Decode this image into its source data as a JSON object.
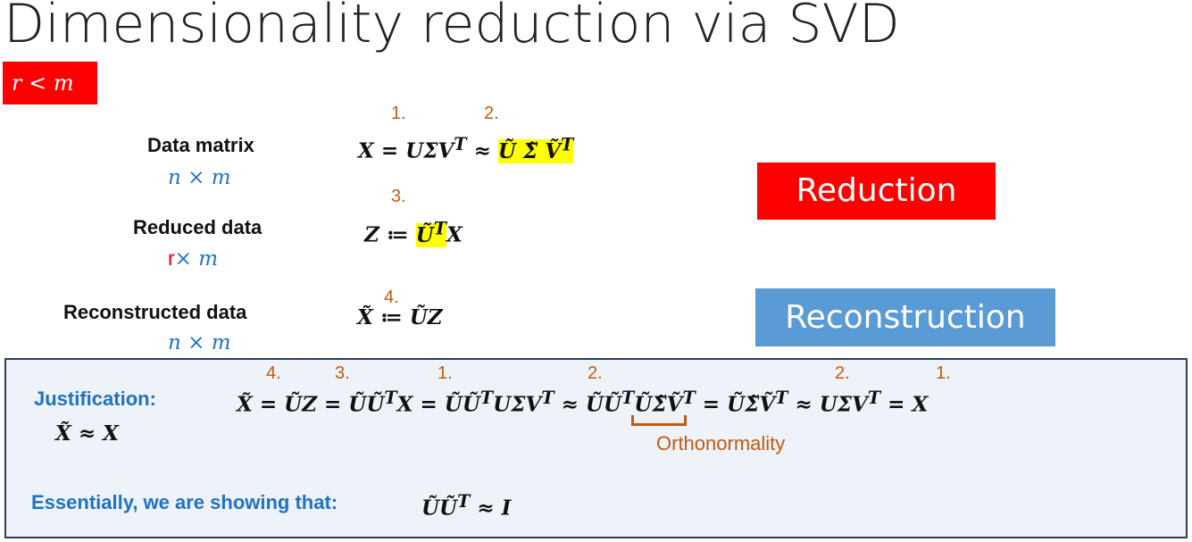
{
  "title": "Dimensionality reduction via SVD",
  "condition": "r < m",
  "rows": {
    "data_matrix": {
      "label": "Data matrix",
      "dim": "n × m",
      "equation": "X = UΣV",
      "equation_sup": "T",
      "approx": " ≈ ",
      "approx_highlight": "Ũ Σ̃ Ṽ",
      "approx_highlight_sup": "T",
      "step_a": "1.",
      "step_b": "2."
    },
    "reduced": {
      "label": "Reduced data",
      "dim_r": "r",
      "dim_rest": "× m",
      "equation_pre": "Z ≔ ",
      "highlight": "Ũ",
      "highlight_sup": "T",
      "equation_post": "X",
      "step": "3."
    },
    "reconstructed": {
      "label": "Reconstructed data",
      "dim": "n × m",
      "equation": "X̃ ≔ ŨZ",
      "step": "4."
    }
  },
  "buttons": {
    "reduction": "Reduction",
    "reconstruction": "Reconstruction"
  },
  "justification": {
    "label": "Justification:",
    "claim": "X̃ ≈ X",
    "eq_part1": "X̃ = ŨZ = ŨŨ",
    "eq_sup1": "T",
    "eq_part2": "X = ŨŨ",
    "eq_sup2": "T",
    "eq_part3": "UΣV",
    "eq_sup3": "T",
    "eq_part4": " ≈ ŨŨ",
    "eq_sup4": "T",
    "eq_part5": "ŨΣ̃Ṽ",
    "eq_sup5": "T",
    "eq_part6": " = ŨΣ̃Ṽ",
    "eq_sup6": "T",
    "eq_part7": " ≈ UΣV",
    "eq_sup7": "T",
    "eq_part8": " = X",
    "steps": [
      "4.",
      "3.",
      "1.",
      "2.",
      "2.",
      "1."
    ],
    "orthonormality": "Orthonormality",
    "essentially_label": "Essentially, we are showing that:",
    "essentially_eq": "ŨŨ",
    "essentially_sup": "T",
    "essentially_tail": " ≈ I"
  }
}
